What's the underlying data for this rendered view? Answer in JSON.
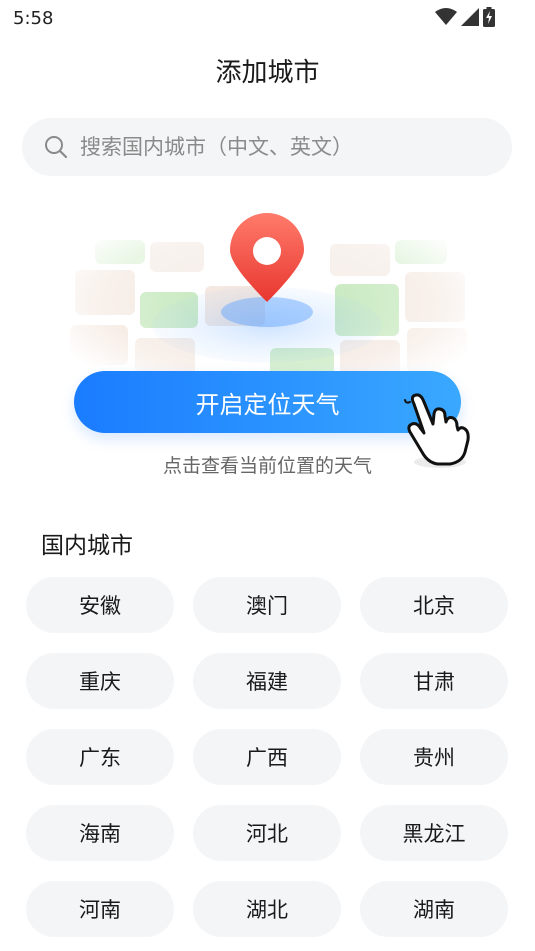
{
  "status_bar": {
    "time": "5:58"
  },
  "page": {
    "title": "添加城市"
  },
  "search": {
    "placeholder": "搜索国内城市（中文、英文）"
  },
  "locate": {
    "button_label": "开启定位天气",
    "hint": "点击查看当前位置的天气"
  },
  "domestic": {
    "section_title": "国内城市",
    "cities": [
      {
        "label": "安徽"
      },
      {
        "label": "澳门"
      },
      {
        "label": "北京"
      },
      {
        "label": "重庆"
      },
      {
        "label": "福建"
      },
      {
        "label": "甘肃"
      },
      {
        "label": "广东"
      },
      {
        "label": "广西"
      },
      {
        "label": "贵州"
      },
      {
        "label": "海南"
      },
      {
        "label": "河北"
      },
      {
        "label": "黑龙江"
      },
      {
        "label": "河南"
      },
      {
        "label": "湖北"
      },
      {
        "label": "湖南"
      }
    ]
  },
  "colors": {
    "accent": "#1a7cff",
    "pin": "#f0453f",
    "chip_bg": "#f4f5f7"
  }
}
